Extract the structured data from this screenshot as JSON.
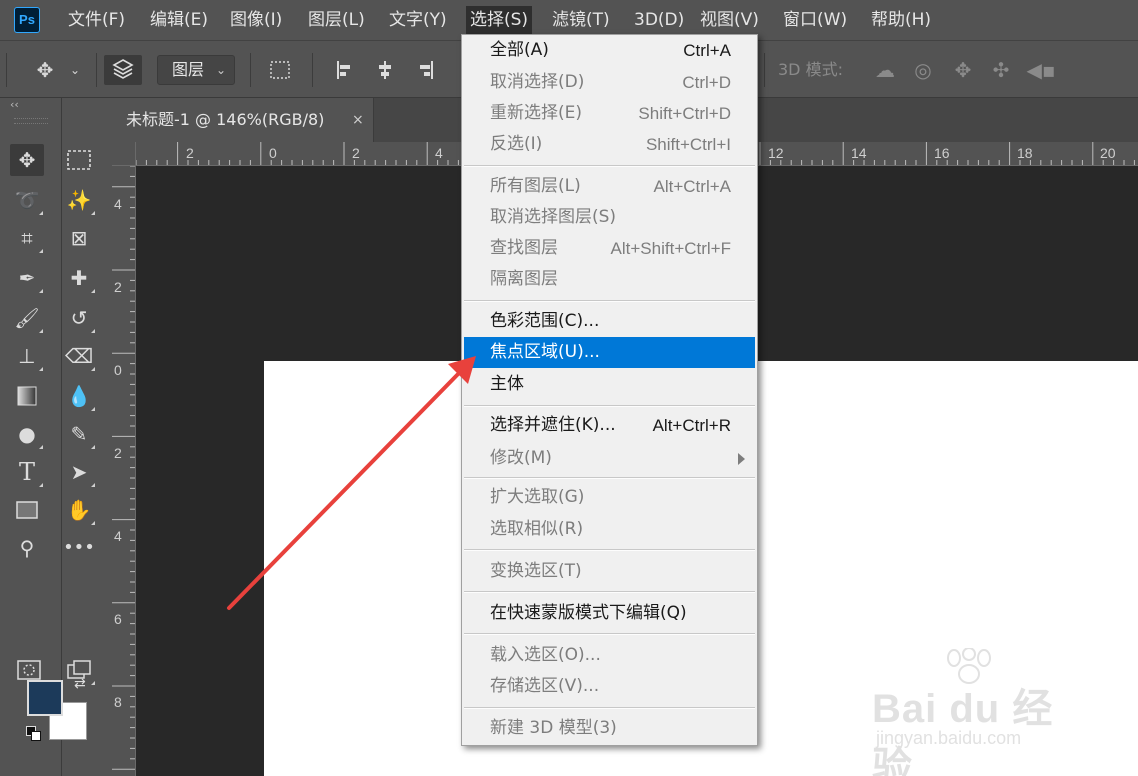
{
  "app": {
    "logo": "Ps"
  },
  "menubar": {
    "items": [
      "文件(F)",
      "编辑(E)",
      "图像(I)",
      "图层(L)",
      "文字(Y)",
      "选择(S)",
      "滤镜(T)",
      "3D(D)",
      "视图(V)",
      "窗口(W)",
      "帮助(H)"
    ],
    "active": "选择(S)"
  },
  "optionsbar": {
    "auto_select_target": "图层",
    "mode3d_label": "3D 模式:"
  },
  "document": {
    "tab_title": "未标题-1 @ 146%(RGB/8)",
    "close_glyph": "×"
  },
  "rulers": {
    "horizontal": [
      "2",
      "0",
      "2",
      "4",
      "12",
      "14",
      "16",
      "18",
      "20"
    ],
    "vertical": [
      "4",
      "2",
      "0",
      "2",
      "4",
      "6",
      "8"
    ]
  },
  "select_menu": {
    "items": [
      {
        "label": "全部(A)",
        "shortcut": "Ctrl+A",
        "enabled": true
      },
      {
        "label": "取消选择(D)",
        "shortcut": "Ctrl+D",
        "enabled": false
      },
      {
        "label": "重新选择(E)",
        "shortcut": "Shift+Ctrl+D",
        "enabled": false
      },
      {
        "label": "反选(I)",
        "shortcut": "Shift+Ctrl+I",
        "enabled": false
      },
      {
        "label": "所有图层(L)",
        "shortcut": "Alt+Ctrl+A",
        "enabled": false
      },
      {
        "label": "取消选择图层(S)",
        "shortcut": "",
        "enabled": false
      },
      {
        "label": "查找图层",
        "shortcut": "Alt+Shift+Ctrl+F",
        "enabled": false
      },
      {
        "label": "隔离图层",
        "shortcut": "",
        "enabled": false
      },
      {
        "label": "色彩范围(C)...",
        "shortcut": "",
        "enabled": true
      },
      {
        "label": "焦点区域(U)...",
        "shortcut": "",
        "enabled": true,
        "highlighted": true
      },
      {
        "label": "主体",
        "shortcut": "",
        "enabled": true
      },
      {
        "label": "选择并遮住(K)...",
        "shortcut": "Alt+Ctrl+R",
        "enabled": true
      },
      {
        "label": "修改(M)",
        "shortcut": "",
        "enabled": false,
        "submenu": true
      },
      {
        "label": "扩大选取(G)",
        "shortcut": "",
        "enabled": false
      },
      {
        "label": "选取相似(R)",
        "shortcut": "",
        "enabled": false
      },
      {
        "label": "变换选区(T)",
        "shortcut": "",
        "enabled": false
      },
      {
        "label": "在快速蒙版模式下编辑(Q)",
        "shortcut": "",
        "enabled": true
      },
      {
        "label": "载入选区(O)...",
        "shortcut": "",
        "enabled": false
      },
      {
        "label": "存储选区(V)...",
        "shortcut": "",
        "enabled": false
      },
      {
        "label": "新建 3D 模型(3)",
        "shortcut": "",
        "enabled": false
      }
    ]
  },
  "colors": {
    "foreground": "#1c3a5a",
    "background": "#ffffff",
    "highlight": "#0078d7",
    "annotation_arrow": "#e8413c"
  },
  "watermark": {
    "logo": "Bai du 经验",
    "site": "jingyan.baidu.com"
  }
}
